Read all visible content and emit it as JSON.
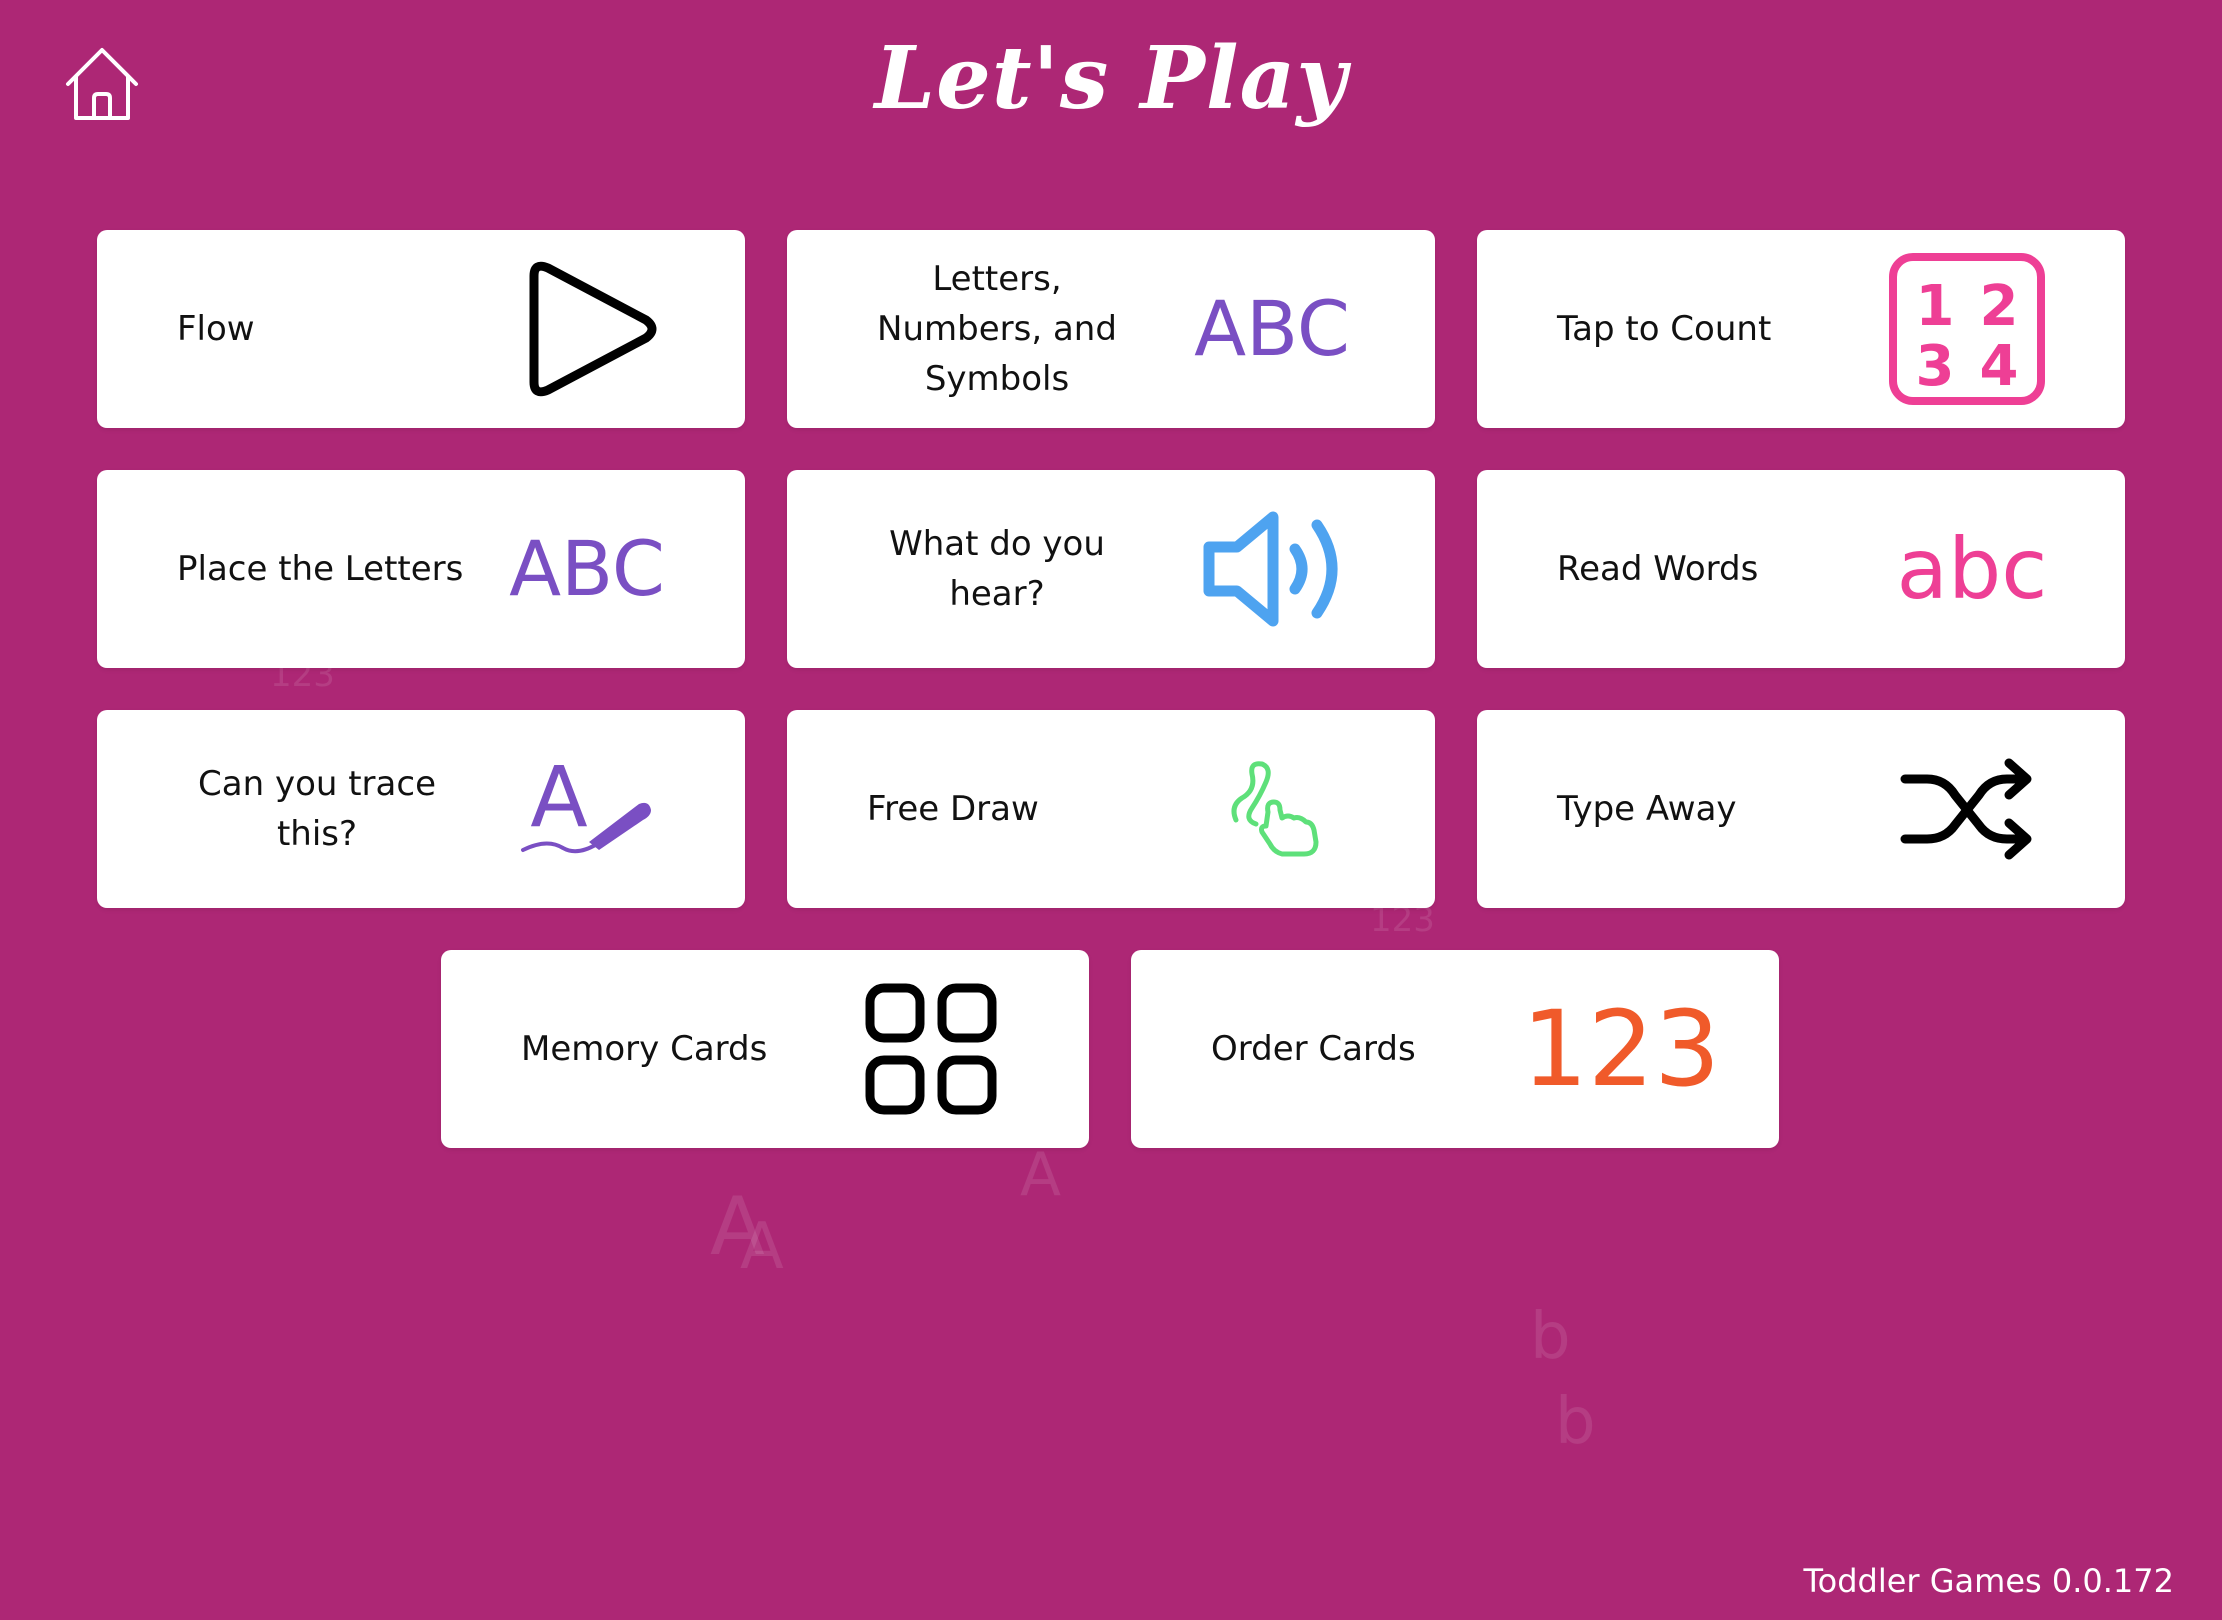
{
  "header": {
    "title": "Let's Play",
    "home_icon": "home-icon"
  },
  "cards": [
    {
      "label": "Flow",
      "icon": "play-icon",
      "color": "#000000"
    },
    {
      "label": "Letters, Numbers, and Symbols",
      "icon_text": "ABC",
      "icon": "abc-uppercase-icon",
      "color": "#7a4fc3"
    },
    {
      "label": "Tap to Count",
      "icon": "numbers-grid-icon",
      "color": "#ee3f95",
      "icon_digits": [
        "1",
        "2",
        "3",
        "4"
      ]
    },
    {
      "label": "Place the Letters",
      "icon_text": "ABC",
      "icon": "abc-uppercase-icon",
      "color": "#7a4fc3"
    },
    {
      "label": "What do you hear?",
      "icon": "speaker-icon",
      "color": "#4ea3f0"
    },
    {
      "label": "Read Words",
      "icon_text": "abc",
      "icon": "abc-lowercase-icon",
      "color": "#ee3f95"
    },
    {
      "label": "Can you trace this?",
      "icon": "trace-letter-icon",
      "color": "#7a4fc3",
      "icon_letter": "A"
    },
    {
      "label": "Free Draw",
      "icon": "finger-draw-icon",
      "color": "#5ee07a"
    },
    {
      "label": "Type Away",
      "icon": "shuffle-icon",
      "color": "#000000"
    },
    {
      "label": "Memory Cards",
      "icon": "grid-squares-icon",
      "color": "#000000"
    },
    {
      "label": "Order Cards",
      "icon_text": "123",
      "icon": "numbers-123-icon",
      "color": "#f05a2a"
    }
  ],
  "footer": {
    "version": "Toddler Games 0.0.172"
  },
  "colors": {
    "background": "#ad2775",
    "card": "#ffffff"
  }
}
